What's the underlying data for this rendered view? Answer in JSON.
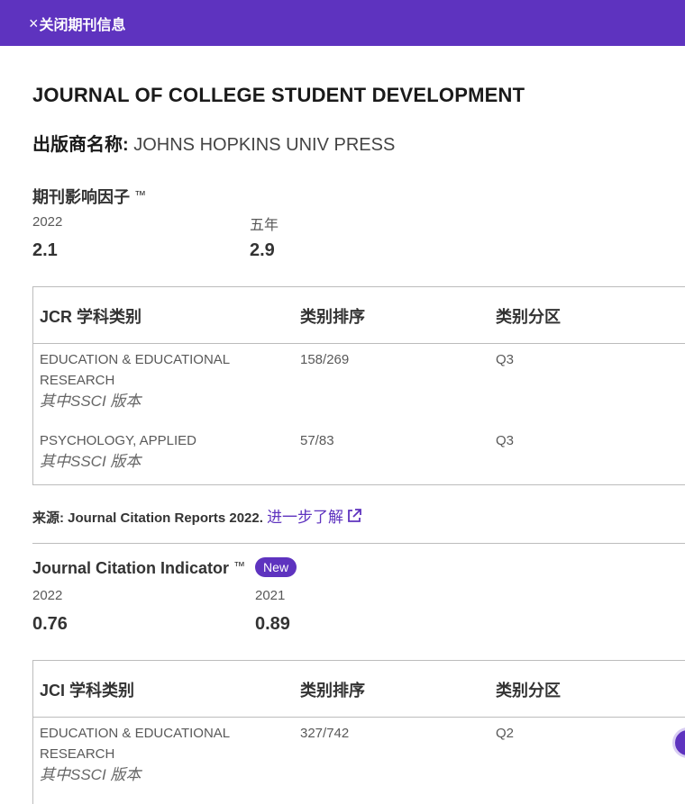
{
  "topbar": {
    "close_label": "关闭期刊信息",
    "close_glyph": "×"
  },
  "journal": {
    "title": "JOURNAL OF COLLEGE STUDENT DEVELOPMENT",
    "publisher_label": "出版商名称:",
    "publisher_value": "JOHNS HOPKINS UNIV PRESS"
  },
  "impact_factor": {
    "heading": "期刊影响因子",
    "tm": "™",
    "metrics": [
      {
        "label": "2022",
        "value": "2.1"
      },
      {
        "label": "五年",
        "value": "2.9"
      }
    ]
  },
  "jcr_table": {
    "headers": [
      "JCR 学科类别",
      "类别排序",
      "类别分区"
    ],
    "rows": [
      {
        "category": "EDUCATION & EDUCATIONAL RESEARCH",
        "edition": "其中SSCI 版本",
        "rank": "158/269",
        "quartile": "Q3"
      },
      {
        "category": "PSYCHOLOGY, APPLIED",
        "edition": "其中SSCI 版本",
        "rank": "57/83",
        "quartile": "Q3"
      }
    ]
  },
  "source": {
    "label": "来源:",
    "text": "Journal Citation Reports  2022.",
    "link": "进一步了解"
  },
  "jci": {
    "heading": "Journal Citation Indicator",
    "tm": "™",
    "badge": "New",
    "metrics": [
      {
        "label": "2022",
        "value": "0.76"
      },
      {
        "label": "2021",
        "value": "0.89"
      }
    ]
  },
  "jci_table": {
    "headers": [
      "JCI 学科类别",
      "类别排序",
      "类别分区"
    ],
    "rows": [
      {
        "category": "EDUCATION & EDUCATIONAL RESEARCH",
        "edition": "其中SSCI 版本",
        "rank": "327/742",
        "quartile": "Q2"
      }
    ]
  },
  "colors": {
    "accent": "#5e33bf",
    "border": "#bcbcbc"
  }
}
